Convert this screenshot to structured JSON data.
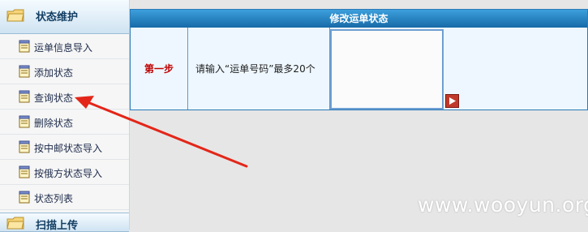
{
  "sidebar": {
    "section1_title": "状态维护",
    "section2_title": "扫描上传",
    "items": [
      {
        "label": "运单信息导入"
      },
      {
        "label": "添加状态"
      },
      {
        "label": "查询状态"
      },
      {
        "label": "删除状态"
      },
      {
        "label": "按中邮状态导入"
      },
      {
        "label": "按俄方状态导入"
      },
      {
        "label": "状态列表"
      }
    ]
  },
  "panel": {
    "title": "修改运单状态",
    "step_label": "第一步",
    "instruction": "请输入“运单号码”最多20个",
    "input_value": ""
  },
  "watermark": "www.wooyun.org",
  "colors": {
    "title_bar": "#2584c6",
    "step_text": "#c00000",
    "arrow": "#e32619",
    "panel_bg": "#eef7ff"
  },
  "icons": {
    "header": "folder-icon",
    "menu_item": "notepad-icon",
    "submit": "play-arrow-icon"
  }
}
